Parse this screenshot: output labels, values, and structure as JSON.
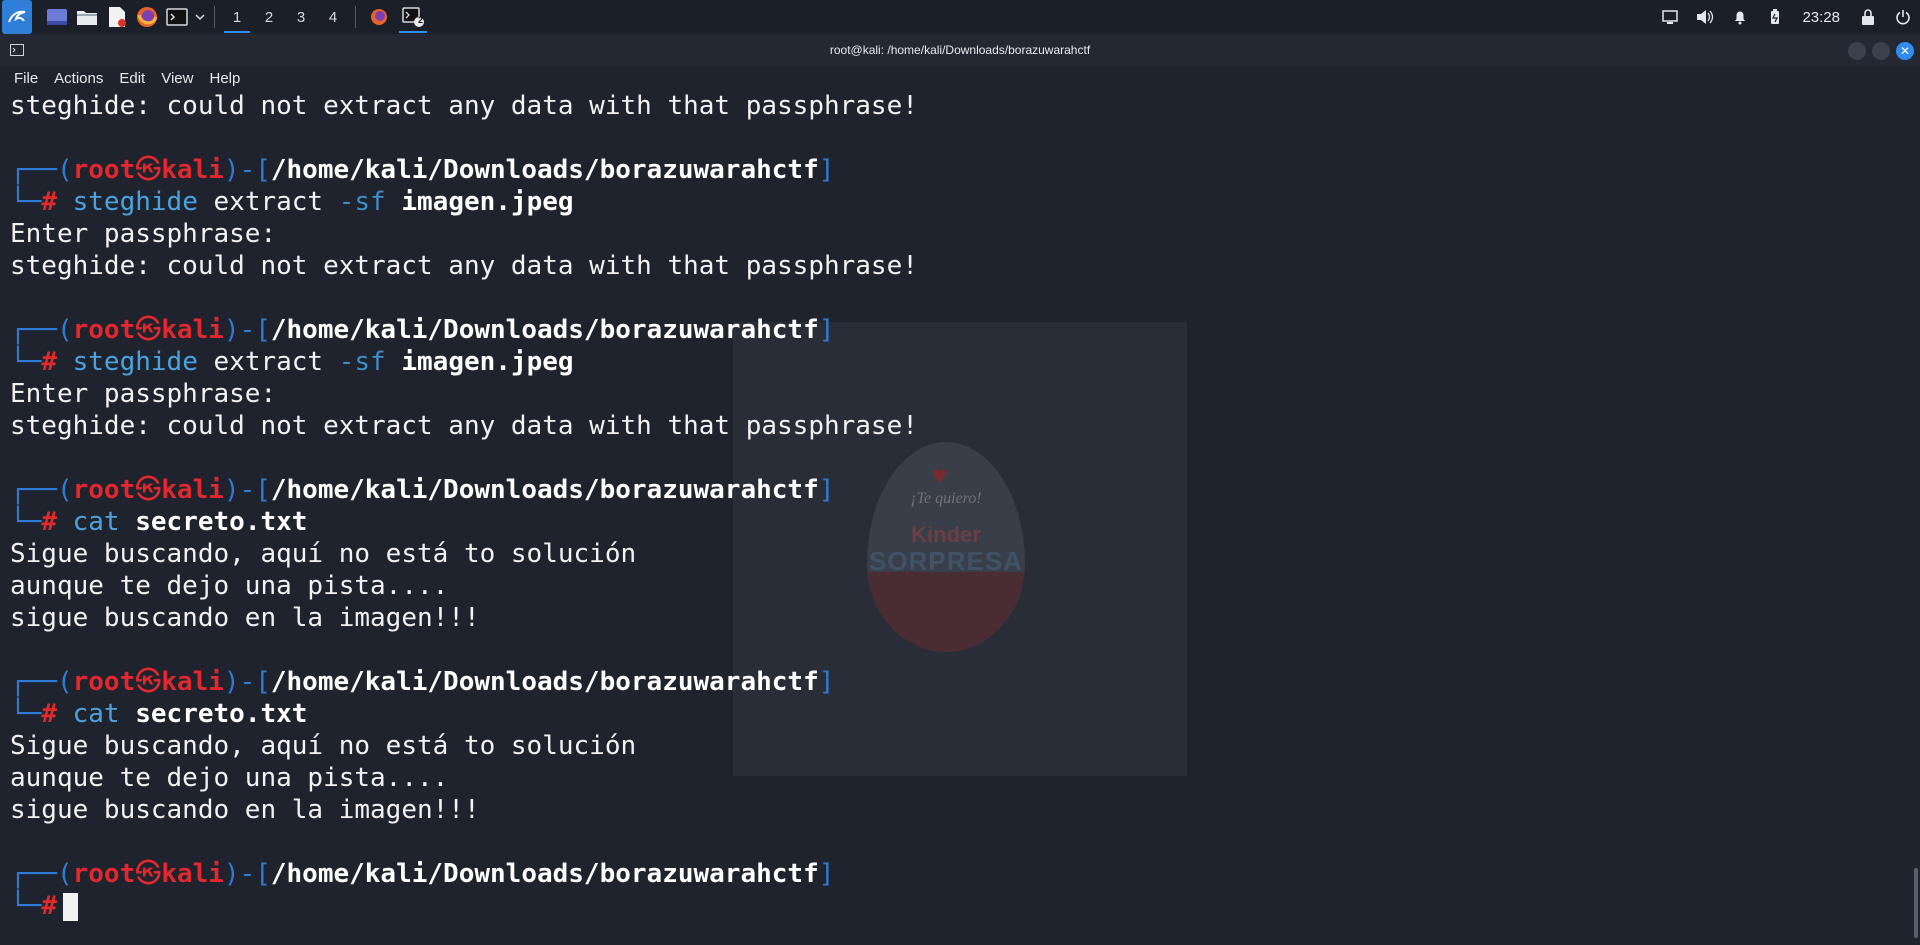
{
  "panel": {
    "workspaces": [
      "1",
      "2",
      "3",
      "4"
    ],
    "active_workspace": "1",
    "terminal_badge": "2",
    "clock": "23:28"
  },
  "window": {
    "title": "root@kali: /home/kali/Downloads/borazuwarahctf"
  },
  "menu": {
    "items": [
      "File",
      "Actions",
      "Edit",
      "View",
      "Help"
    ]
  },
  "background_image": {
    "heart": "♥",
    "caption": "¡Te quiero!",
    "brand": "Kinder",
    "sub": "SORPRESA"
  },
  "terminal": {
    "prompt": {
      "user": "root",
      "separator": "㉿",
      "host": "kali",
      "path": "/home/kali/Downloads/borazuwarahctf",
      "hash": "#"
    },
    "top_line": "steghide: could not extract any data with that passphrase!",
    "blocks": [
      {
        "cmd": "steghide",
        "args": " extract ",
        "opt": "-sf",
        "file": " imagen.jpeg",
        "output": [
          "Enter passphrase:",
          "steghide: could not extract any data with that passphrase!"
        ]
      },
      {
        "cmd": "steghide",
        "args": " extract ",
        "opt": "-sf",
        "file": " imagen.jpeg",
        "output": [
          "Enter passphrase:",
          "steghide: could not extract any data with that passphrase!"
        ]
      },
      {
        "cmd": "cat",
        "args": "",
        "opt": "",
        "file": " secreto.txt",
        "output": [
          "Sigue buscando, aquí no está to solución",
          "aunque te dejo una pista....",
          "sigue buscando en la imagen!!!"
        ]
      },
      {
        "cmd": "cat",
        "args": "",
        "opt": "",
        "file": " secreto.txt",
        "output": [
          "Sigue buscando, aquí no está to solución",
          "aunque te dejo una pista....",
          "sigue buscando en la imagen!!!"
        ]
      }
    ]
  }
}
